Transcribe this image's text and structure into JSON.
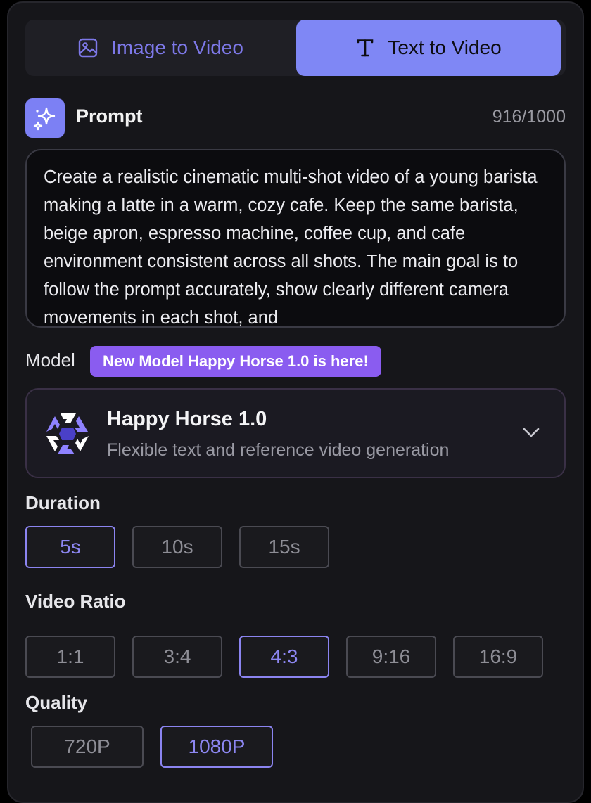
{
  "tabs": [
    {
      "label": "Image to Video",
      "icon": "image-icon",
      "selected": false
    },
    {
      "label": "Text to Video",
      "icon": "text-icon",
      "selected": true
    }
  ],
  "prompt": {
    "label": "Prompt",
    "count": "916/1000",
    "text": "Create a realistic cinematic multi-shot video of a young barista making a latte in a warm, cozy cafe. Keep the same barista, beige apron, espresso machine, coffee cup, and cafe environment consistent across all shots. The main goal is to follow the prompt accurately, show clearly different camera movements in each shot, and"
  },
  "model": {
    "label": "Model",
    "badge": "New Model Happy Horse 1.0 is here!",
    "name": "Happy Horse 1.0",
    "description": "Flexible text and reference video generation"
  },
  "duration": {
    "label": "Duration",
    "options": [
      "5s",
      "10s",
      "15s"
    ],
    "selected": "5s"
  },
  "ratio": {
    "label": "Video Ratio",
    "options": [
      "1:1",
      "3:4",
      "4:3",
      "9:16",
      "16:9"
    ],
    "selected": "4:3"
  },
  "quality": {
    "label": "Quality",
    "options": [
      "720P",
      "1080P"
    ],
    "selected": "1080P"
  },
  "colors": {
    "accent": "#7f87f5",
    "badge": "#8a5cf0",
    "background": "#16161a"
  }
}
